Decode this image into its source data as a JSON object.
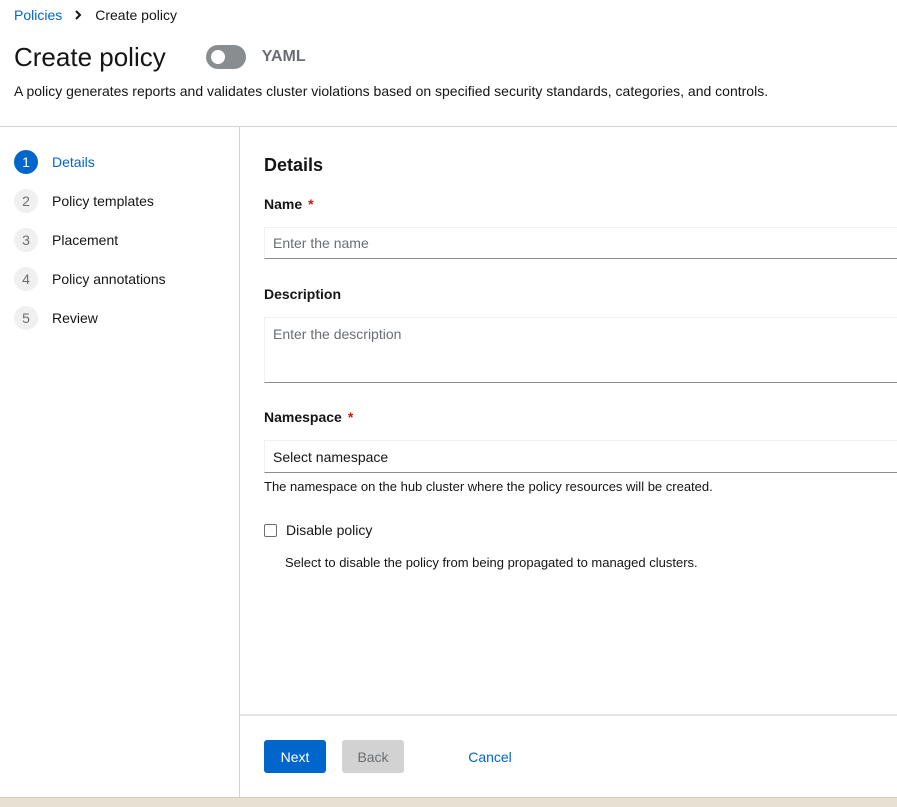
{
  "breadcrumb": {
    "parent": "Policies",
    "current": "Create policy"
  },
  "header": {
    "title": "Create policy",
    "yaml_label": "YAML",
    "description": "A policy generates reports and validates cluster violations based on specified security standards, categories, and controls."
  },
  "steps": [
    {
      "number": "1",
      "label": "Details"
    },
    {
      "number": "2",
      "label": "Policy templates"
    },
    {
      "number": "3",
      "label": "Placement"
    },
    {
      "number": "4",
      "label": "Policy annotations"
    },
    {
      "number": "5",
      "label": "Review"
    }
  ],
  "form": {
    "section_title": "Details",
    "name_label": "Name",
    "required_mark": "*",
    "name_placeholder": "Enter the name",
    "description_label": "Description",
    "description_placeholder": "Enter the description",
    "namespace_label": "Namespace",
    "namespace_placeholder": "Select namespace",
    "namespace_helper": "The namespace on the hub cluster where the policy resources will be created.",
    "disable_label": "Disable policy",
    "disable_helper": "Select to disable the policy from being propagated to managed clusters."
  },
  "footer": {
    "next": "Next",
    "back": "Back",
    "cancel": "Cancel"
  },
  "colors": {
    "accent": "#0066cc",
    "required": "#c9190b",
    "toggle_off": "#8a8d90"
  }
}
